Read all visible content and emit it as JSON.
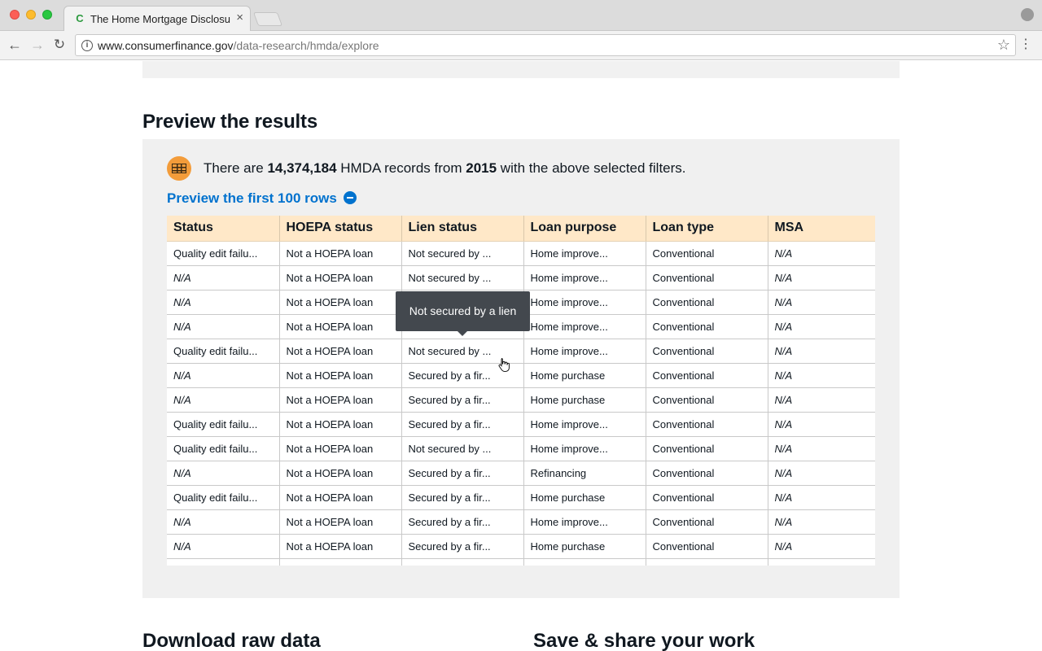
{
  "browser": {
    "tab_title": "The Home Mortgage Disclosure Act | Consumer Financial Protection Bureau",
    "tab_close": "×",
    "url_host": "www.consumerfinance.gov",
    "url_path": "/data-research/hmda/explore"
  },
  "page": {
    "section_title": "Preview the results",
    "summary": {
      "prefix": "There are ",
      "count": "14,374,184",
      "middle": " HMDA records from ",
      "year": "2015",
      "suffix": " with the above selected filters."
    },
    "preview_link": "Preview the first 100 rows",
    "table": {
      "headers": [
        "Status",
        "HOEPA status",
        "Lien status",
        "Loan purpose",
        "Loan type",
        "MSA"
      ],
      "rows": [
        [
          "Quality edit failu...",
          "Not a HOEPA loan",
          "Not secured by ...",
          "Home improve...",
          "Conventional",
          "N/A"
        ],
        [
          "N/A",
          "Not a HOEPA loan",
          "Not secured by ...",
          "Home improve...",
          "Conventional",
          "N/A"
        ],
        [
          "N/A",
          "Not a HOEPA loan",
          "",
          "Home improve...",
          "Conventional",
          "N/A"
        ],
        [
          "N/A",
          "Not a HOEPA loan",
          "",
          "Home improve...",
          "Conventional",
          "N/A"
        ],
        [
          "Quality edit failu...",
          "Not a HOEPA loan",
          "Not secured by ...",
          "Home improve...",
          "Conventional",
          "N/A"
        ],
        [
          "N/A",
          "Not a HOEPA loan",
          "Secured by a fir...",
          "Home purchase",
          "Conventional",
          "N/A"
        ],
        [
          "N/A",
          "Not a HOEPA loan",
          "Secured by a fir...",
          "Home purchase",
          "Conventional",
          "N/A"
        ],
        [
          "Quality edit failu...",
          "Not a HOEPA loan",
          "Secured by a fir...",
          "Home improve...",
          "Conventional",
          "N/A"
        ],
        [
          "Quality edit failu...",
          "Not a HOEPA loan",
          "Not secured by ...",
          "Home improve...",
          "Conventional",
          "N/A"
        ],
        [
          "N/A",
          "Not a HOEPA loan",
          "Secured by a fir...",
          "Refinancing",
          "Conventional",
          "N/A"
        ],
        [
          "Quality edit failu...",
          "Not a HOEPA loan",
          "Secured by a fir...",
          "Home purchase",
          "Conventional",
          "N/A"
        ],
        [
          "N/A",
          "Not a HOEPA loan",
          "Secured by a fir...",
          "Home improve...",
          "Conventional",
          "N/A"
        ],
        [
          "N/A",
          "Not a HOEPA loan",
          "Secured by a fir...",
          "Home purchase",
          "Conventional",
          "N/A"
        ],
        [
          "",
          "",
          "",
          "",
          "",
          ""
        ]
      ]
    },
    "tooltip": "Not secured by a lien",
    "bottom_left_title": "Download raw data",
    "bottom_right_title": "Save & share your work"
  },
  "icons": {
    "favicon": "C",
    "back": "←",
    "forward": "→",
    "reload": "↻",
    "info": "i",
    "star": "☆",
    "menu": "⋮"
  },
  "colors": {
    "link": "#0072ce",
    "table_header": "#ffe8c8",
    "panel_bg": "#f0f0f0",
    "icon_orange": "#f39c3a",
    "tooltip_bg": "#43484e"
  }
}
